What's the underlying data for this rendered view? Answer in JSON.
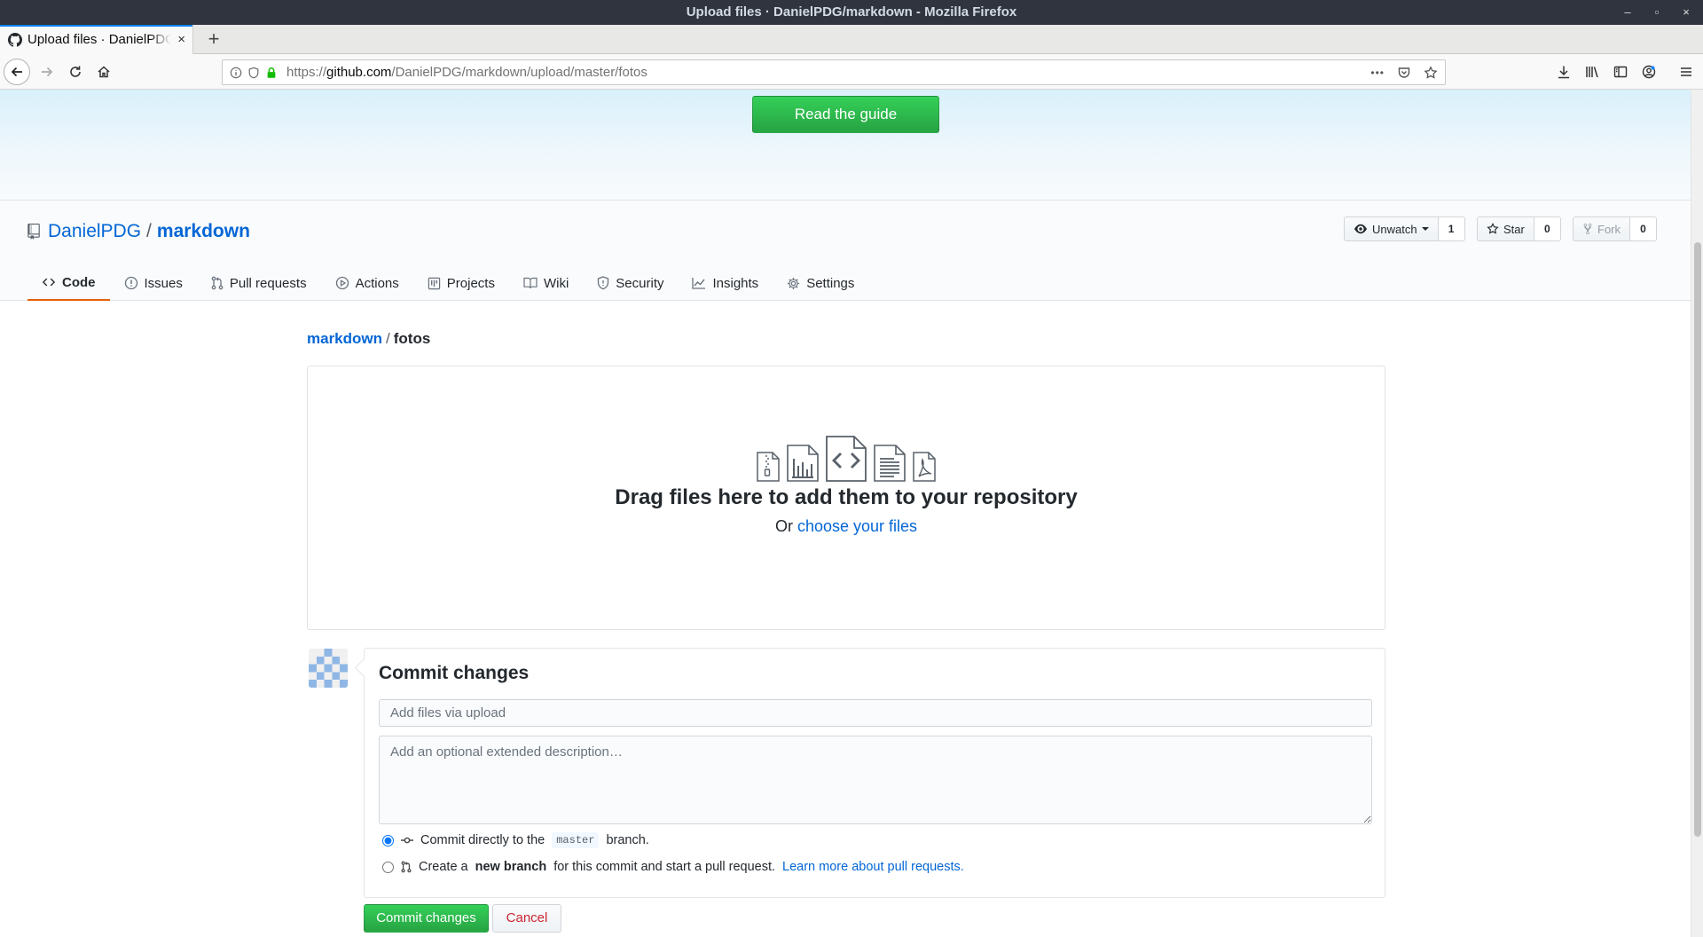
{
  "window": {
    "title": "Upload files · DanielPDG/markdown - Mozilla Firefox",
    "controls": [
      "–",
      "▫",
      "×"
    ]
  },
  "browser": {
    "tab_title": "Upload files · DanielPDG/markdown",
    "tab_close": "×",
    "new_tab": "+",
    "url_prefix": "https://",
    "url_domain": "github.com",
    "url_path": "/DanielPDG/markdown/upload/master/fotos",
    "page_actions": "•••"
  },
  "banner": {
    "guide_label": "Read the guide"
  },
  "repo": {
    "owner": "DanielPDG",
    "separator": "/",
    "name": "markdown",
    "unwatch_label": "Unwatch",
    "watch_count": "1",
    "star_label": "Star",
    "star_count": "0",
    "fork_label": "Fork",
    "fork_count": "0"
  },
  "nav": {
    "tabs": [
      {
        "label": "Code",
        "icon": "code-icon"
      },
      {
        "label": "Issues",
        "icon": "issue-icon"
      },
      {
        "label": "Pull requests",
        "icon": "pull-request-icon"
      },
      {
        "label": "Actions",
        "icon": "play-icon"
      },
      {
        "label": "Projects",
        "icon": "project-icon"
      },
      {
        "label": "Wiki",
        "icon": "book-icon"
      },
      {
        "label": "Security",
        "icon": "shield-icon"
      },
      {
        "label": "Insights",
        "icon": "graph-icon"
      },
      {
        "label": "Settings",
        "icon": "gear-icon"
      }
    ]
  },
  "breadcrumb": {
    "root": "markdown",
    "separator": "/",
    "current": "fotos"
  },
  "dropzone": {
    "title": "Drag files here to add them to your repository",
    "or_text": "Or",
    "choose_label": "choose your files"
  },
  "commit": {
    "title": "Commit changes",
    "summary_placeholder": "Add files via upload",
    "description_placeholder": "Add an optional extended description…",
    "direct_prefix": "Commit directly to the",
    "branch_name": "master",
    "direct_suffix": "branch.",
    "new_prefix": "Create a",
    "new_bold": "new branch",
    "new_suffix": "for this commit and start a pull request.",
    "learn_more": "Learn more about pull requests.",
    "submit_label": "Commit changes",
    "cancel_label": "Cancel"
  },
  "colors": {
    "accent": "#0366d6",
    "primary_button": "#28a745",
    "active_tab_underline": "#e36209",
    "cancel_text": "#cb2431"
  }
}
